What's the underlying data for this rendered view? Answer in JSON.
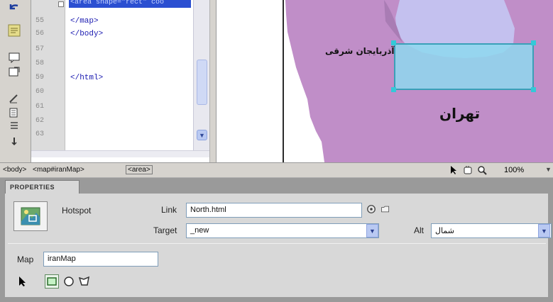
{
  "code_view": {
    "line_numbers": [
      "55",
      "56",
      "57",
      "58",
      "59",
      "60",
      "61",
      "62",
      "63"
    ],
    "code_lines": [
      "</map>",
      "</body>",
      "",
      "",
      "</html>",
      "",
      "",
      "",
      ""
    ],
    "selected_text": "<area shape=\"rect\" coo"
  },
  "design_view": {
    "labels": {
      "east_azerbaijan": "آذربایجان شرقی",
      "tehran": "تهران"
    },
    "colors": {
      "province": "#c08ec8",
      "province_light": "#c4c1ef",
      "hotspot_fill": "#8ed8ee",
      "hotspot_border": "#3aa0b8"
    }
  },
  "tag_selector": {
    "crumbs": [
      "<body>",
      "<map#iranMap>",
      "<area>"
    ],
    "zoom": "100%"
  },
  "properties": {
    "panel_title": "PROPERTIES",
    "hotspot_label": "Hotspot",
    "link_label": "Link",
    "link_value": "North.html",
    "target_label": "Target",
    "target_value": "_new",
    "alt_label": "Alt",
    "alt_value": "شمال",
    "map_label": "Map",
    "map_value": "iranMap"
  }
}
